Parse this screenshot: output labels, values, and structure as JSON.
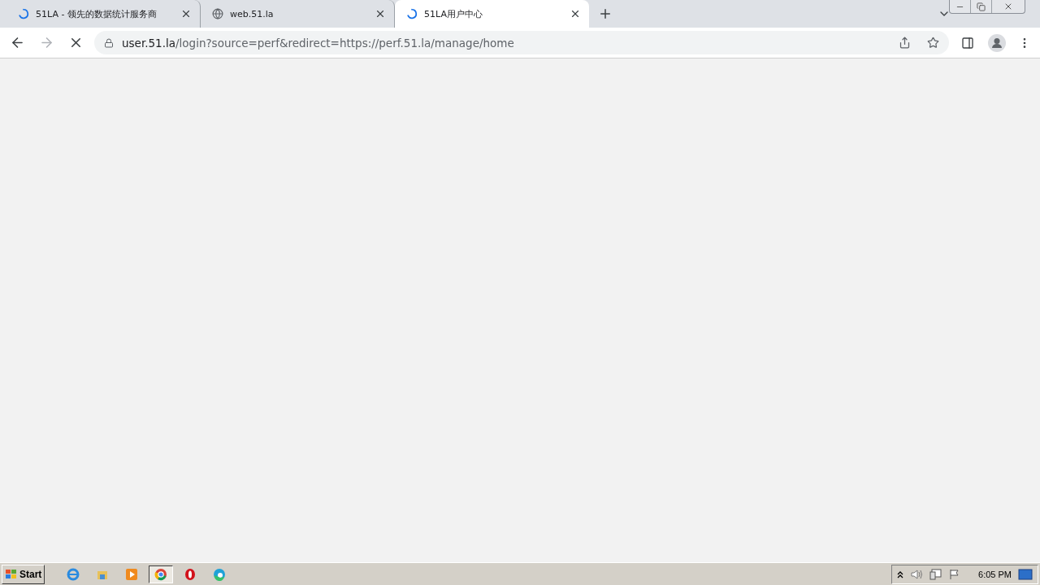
{
  "tabs": [
    {
      "kind": "loading",
      "title": "51LA - 领先的数据统计服务商",
      "selected": false
    },
    {
      "kind": "globe",
      "title": "web.51.la",
      "selected": false
    },
    {
      "kind": "loading",
      "title": "51LA用户中心",
      "selected": true
    }
  ],
  "address_bar": {
    "host": "user.51.la",
    "path": "/login?source=perf&redirect=https://perf.51.la/manage/home"
  },
  "taskbar": {
    "start": "Start",
    "apps": [
      {
        "kind": "ie",
        "selected": false
      },
      {
        "kind": "explorer",
        "selected": false
      },
      {
        "kind": "media",
        "selected": false
      },
      {
        "kind": "chrome",
        "selected": true
      },
      {
        "kind": "opera",
        "selected": false
      },
      {
        "kind": "edge",
        "selected": false
      }
    ],
    "clock": "6:05 PM"
  }
}
